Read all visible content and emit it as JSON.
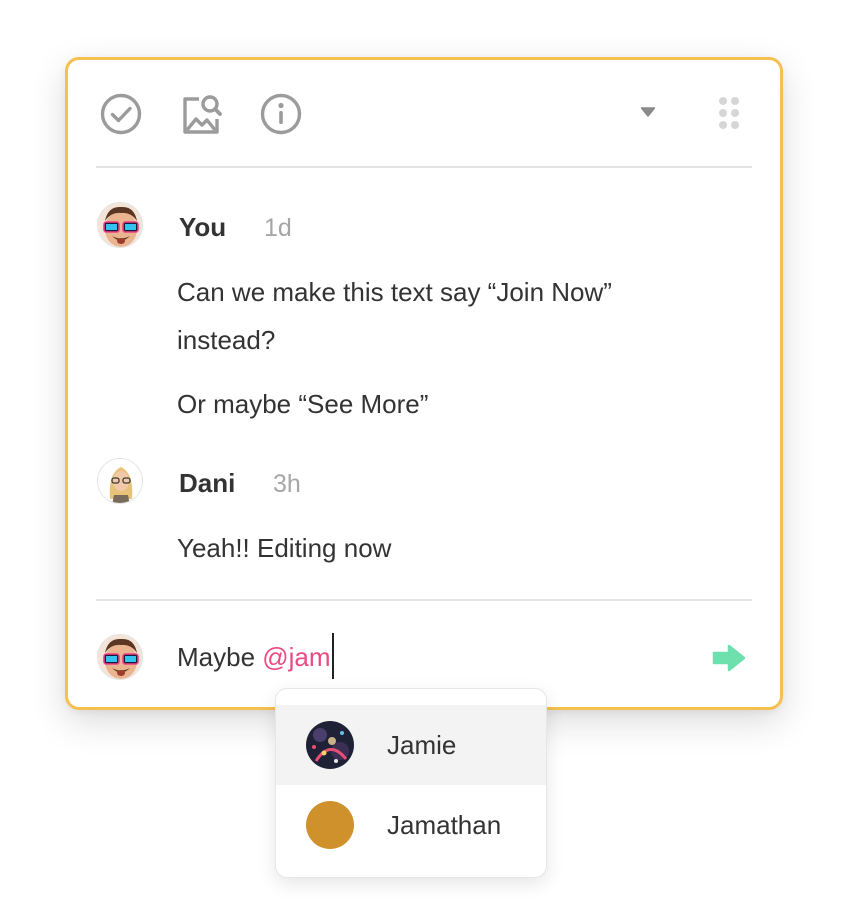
{
  "toolbar": {
    "icons": [
      "resolve-check-icon",
      "image-search-icon",
      "info-icon",
      "caret-down-icon",
      "drag-handle-icon"
    ]
  },
  "comments": [
    {
      "author": "You",
      "time": "1d",
      "avatar_icon": "bitmoji-avatar-you",
      "messages": [
        "Can we make this text say “Join Now” instead?",
        "Or maybe “See More”"
      ]
    },
    {
      "author": "Dani",
      "time": "3h",
      "avatar_icon": "bitmoji-avatar-dani",
      "messages": [
        "Yeah!! Editing now"
      ]
    }
  ],
  "composer": {
    "text": "Maybe ",
    "mention": "@jam",
    "send_icon": "send-arrow-icon"
  },
  "mention_suggestions": [
    {
      "name": "Jamie",
      "avatar_icon": "photo-avatar-jamie",
      "highlighted": true
    },
    {
      "name": "Jamathan",
      "avatar_color": "#cf912c",
      "highlighted": false
    }
  ],
  "colors": {
    "panel_border": "#f6c04f",
    "mention": "#ec4a82",
    "send_button": "#6ee0ae",
    "icon_gray": "#9b9b9b"
  }
}
